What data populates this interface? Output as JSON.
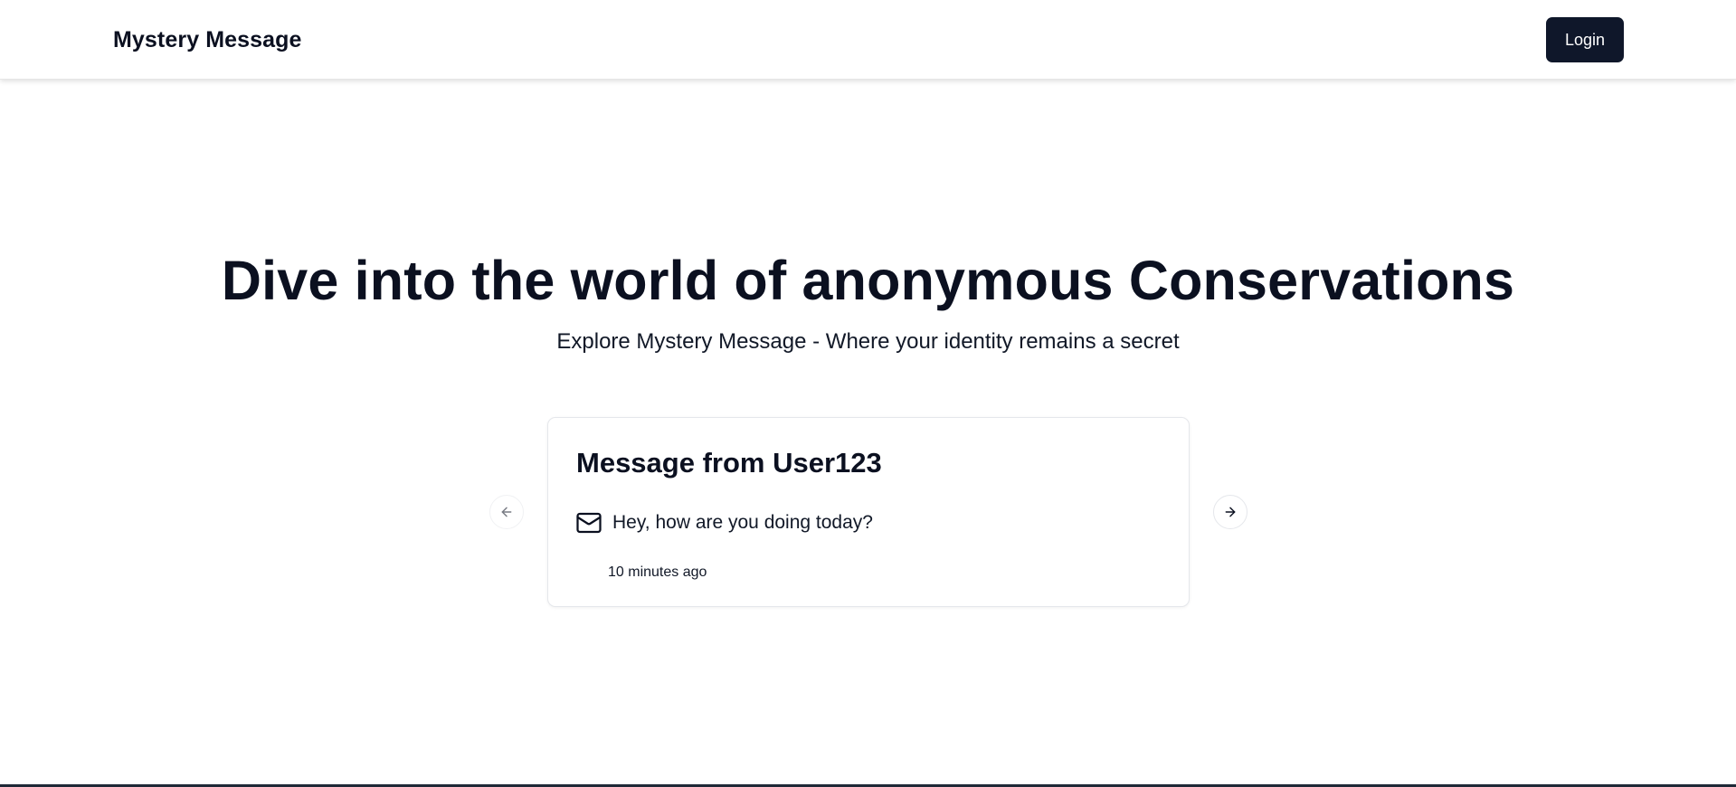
{
  "navbar": {
    "brand": "Mystery Message",
    "login_label": "Login"
  },
  "hero": {
    "title": "Dive into the world of anonymous Conservations",
    "subtitle": "Explore Mystery Message - Where your identity remains a secret"
  },
  "carousel": {
    "prev_icon": "arrow-left-icon",
    "next_icon": "arrow-right-icon",
    "current_message": {
      "title": "Message from User123",
      "icon": "mail-icon",
      "content": "Hey, how are you doing today?",
      "received": "10 minutes ago"
    }
  },
  "colors": {
    "primary": "#0f172a",
    "text": "#0b1020",
    "border": "#e5e7eb"
  }
}
